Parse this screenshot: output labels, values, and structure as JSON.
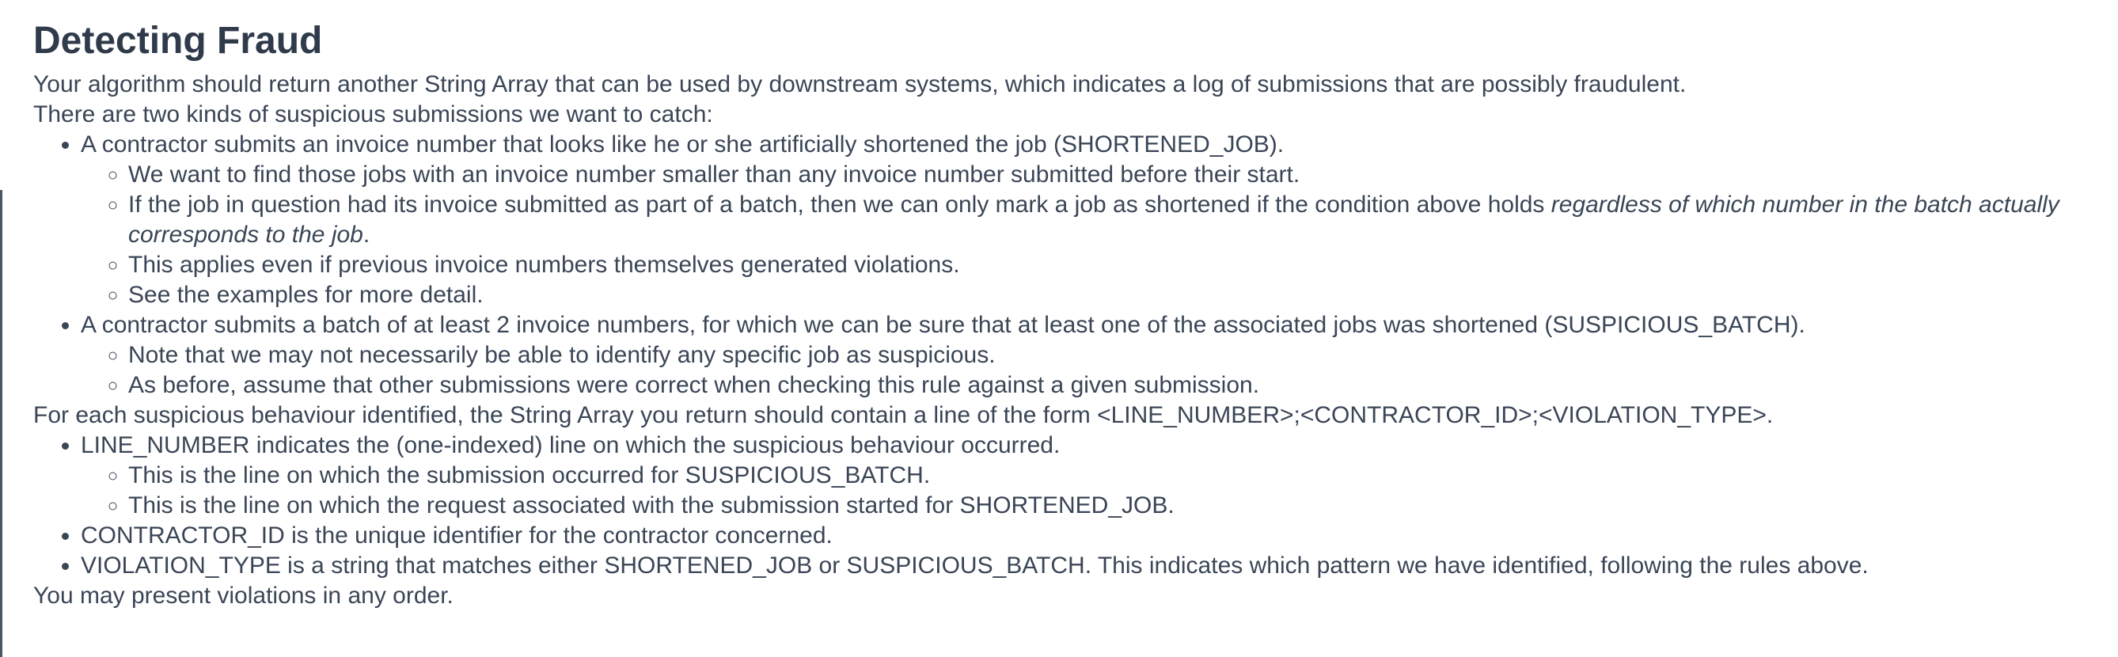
{
  "doc": {
    "title": "Detecting Fraud",
    "intro1": "Your algorithm should return another String Array that can be used by downstream systems, which indicates a log of submissions that are possibly fraudulent.",
    "intro2": "There are two kinds of suspicious submissions we want to catch:",
    "kinds": [
      {
        "text": "A contractor submits an invoice number that looks like he or she artificially shortened the job (SHORTENED_JOB).",
        "sub": [
          "We want to find those jobs with an invoice number smaller than any invoice number submitted before their start.",
          {
            "pre": "If the job in question had its invoice submitted as part of a batch, then we can only mark a job as shortened if the condition above holds ",
            "em": "regardless of which number in the batch actually corresponds to the job",
            "post": "."
          },
          "This applies even if previous invoice numbers themselves generated violations.",
          "See the examples for more detail."
        ]
      },
      {
        "text": "A contractor submits a batch of at least 2 invoice numbers, for which we can be sure that at least one of the associated jobs was shortened (SUSPICIOUS_BATCH).",
        "sub": [
          "Note that we may not necessarily be able to identify any specific job as suspicious.",
          "As before, assume that other submissions were correct when checking this rule against a given submission."
        ]
      }
    ],
    "format_line": "For each suspicious behaviour identified, the String Array you return should contain a line of the form <LINE_NUMBER>;<CONTRACTOR_ID>;<VIOLATION_TYPE>.",
    "fields": [
      {
        "text": "LINE_NUMBER indicates the (one-indexed) line on which the suspicious behaviour occurred.",
        "sub": [
          "This is the line on which the submission occurred for SUSPICIOUS_BATCH.",
          "This is the line on which the request associated with the submission started for SHORTENED_JOB."
        ]
      },
      {
        "text": "CONTRACTOR_ID is the unique identifier for the contractor concerned."
      },
      {
        "text": "VIOLATION_TYPE is a string that matches either SHORTENED_JOB or SUSPICIOUS_BATCH. This indicates which pattern we have identified, following the rules above."
      }
    ],
    "closing": "You may present violations in any order."
  }
}
